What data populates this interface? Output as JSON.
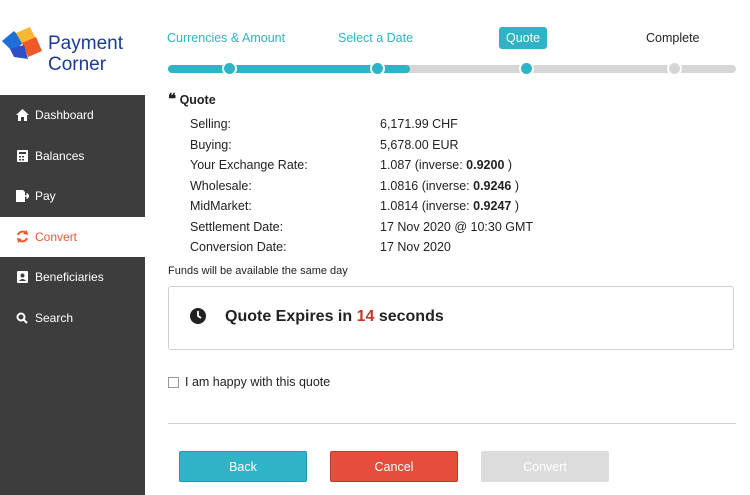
{
  "brand": {
    "line1": "Payment",
    "line2": "Corner"
  },
  "nav": [
    {
      "label": "Dashboard",
      "icon": "home-icon"
    },
    {
      "label": "Balances",
      "icon": "calculator-icon"
    },
    {
      "label": "Pay",
      "icon": "pay-icon"
    },
    {
      "label": "Convert",
      "icon": "refresh-icon",
      "active": true
    },
    {
      "label": "Beneficiaries",
      "icon": "contact-card-icon"
    },
    {
      "label": "Search",
      "icon": "search-icon"
    }
  ],
  "steps": [
    {
      "label": "Currencies & Amount"
    },
    {
      "label": "Select a Date"
    },
    {
      "label": "Quote"
    },
    {
      "label": "Complete"
    }
  ],
  "progress": {
    "current_step": 3,
    "total_steps": 4
  },
  "quote": {
    "title": "Quote",
    "selling_label": "Selling:",
    "selling_value": "6,171.99 CHF",
    "buying_label": "Buying:",
    "buying_value": "5,678.00 EUR",
    "your_rate_label": "Your Exchange Rate:",
    "your_rate_value": "1.087",
    "your_rate_inverse": "0.9200",
    "wholesale_label": "Wholesale:",
    "wholesale_value": "1.0816",
    "wholesale_inverse": "0.9246",
    "midmarket_label": "MidMarket:",
    "midmarket_value": "1.0814",
    "midmarket_inverse": "0.9247",
    "settlement_label": "Settlement Date:",
    "settlement_value": "17 Nov 2020 @ 10:30 GMT",
    "conversion_label": "Conversion Date:",
    "conversion_value": "17 Nov 2020",
    "inverse_prefix": "(inverse: ",
    "inverse_suffix": " )"
  },
  "funds_note": "Funds will be available the same day",
  "expiry": {
    "prefix": "Quote Expires in ",
    "seconds": "14",
    "suffix": " seconds"
  },
  "confirm_label": "I am happy with this quote",
  "buttons": {
    "back": "Back",
    "cancel": "Cancel",
    "convert": "Convert"
  },
  "colors": {
    "accent": "#2fb3c6",
    "danger": "#e74c3c",
    "sidebar": "#3d3d3d",
    "active_nav": "#f05a28",
    "brand": "#1b3a9c"
  }
}
